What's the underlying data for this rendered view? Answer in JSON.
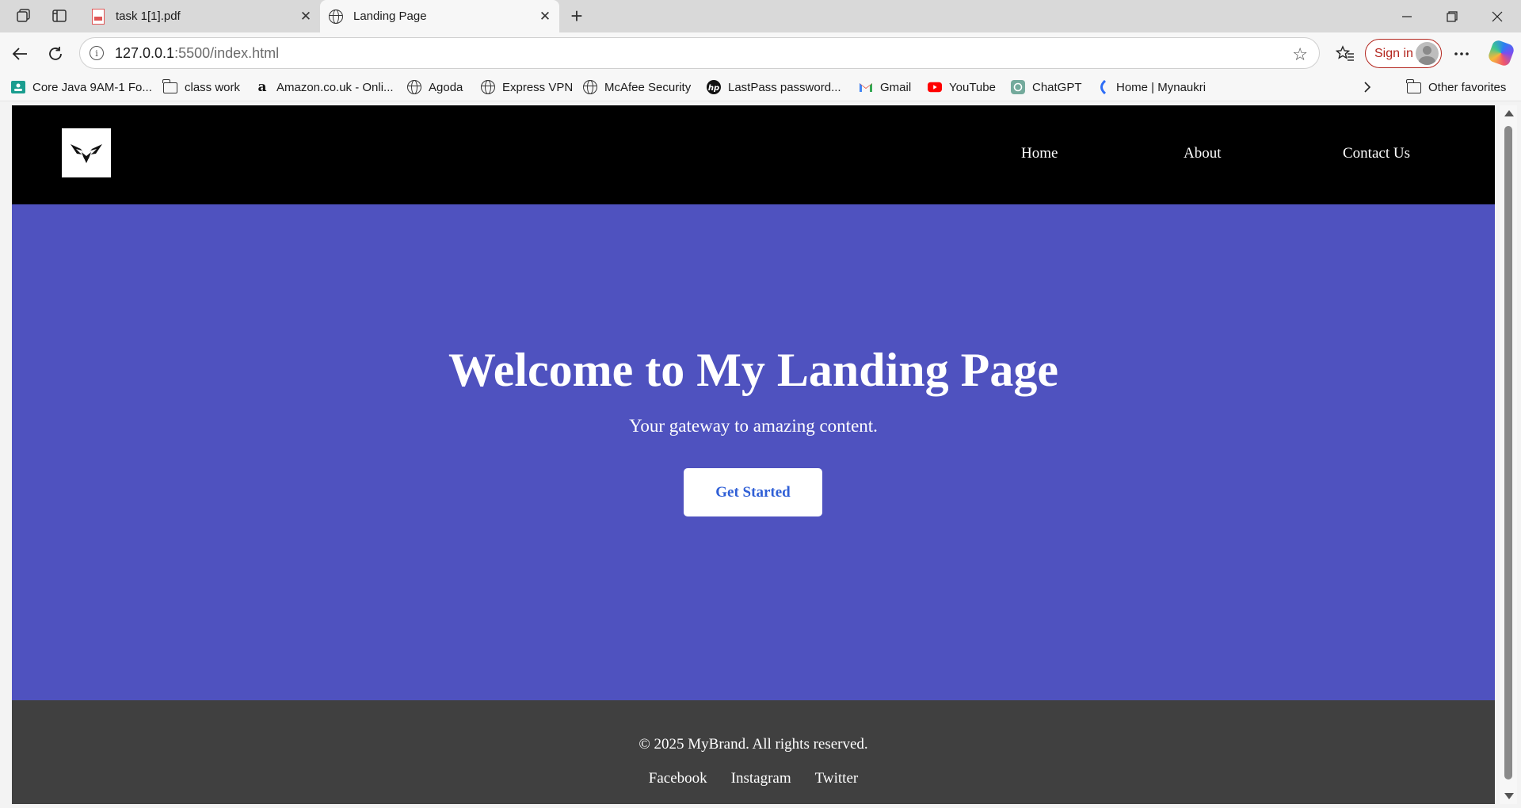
{
  "browser": {
    "tabs": [
      {
        "title": "task 1[1].pdf",
        "icon": "pdf-icon",
        "active": false
      },
      {
        "title": "Landing Page",
        "icon": "globe-icon",
        "active": true
      }
    ],
    "address": {
      "host": "127.0.0.1",
      "path": ":5500/index.html"
    },
    "sign_in_label": "Sign in",
    "bookmarks": [
      {
        "label": "Core Java 9AM-1 Fo...",
        "icon": "classroom-icon"
      },
      {
        "label": "class work",
        "icon": "folder-icon"
      },
      {
        "label": "Amazon.co.uk - Onli...",
        "icon": "amazon-icon"
      },
      {
        "label": "Agoda",
        "icon": "globe-icon"
      },
      {
        "label": "Express VPN",
        "icon": "globe-icon"
      },
      {
        "label": "McAfee Security",
        "icon": "globe-icon"
      },
      {
        "label": "LastPass password...",
        "icon": "hp-icon"
      },
      {
        "label": "Gmail",
        "icon": "gmail-icon"
      },
      {
        "label": "YouTube",
        "icon": "youtube-icon"
      },
      {
        "label": "ChatGPT",
        "icon": "chatgpt-icon"
      },
      {
        "label": "Home | Mynaukri",
        "icon": "naukri-icon"
      }
    ],
    "other_favorites_label": "Other favorites"
  },
  "site": {
    "nav": {
      "home": "Home",
      "about": "About",
      "contact": "Contact Us"
    },
    "hero": {
      "title": "Welcome to My Landing Page",
      "subtitle": "Your gateway to amazing content.",
      "cta_label": "Get Started"
    },
    "footer": {
      "copyright": "© 2025 MyBrand. All rights reserved.",
      "links": [
        "Facebook",
        "Instagram",
        "Twitter"
      ]
    }
  },
  "colors": {
    "header_bg": "#000000",
    "hero_bg": "#4f52bf",
    "footer_bg": "#404040",
    "cta_text": "#2f5fd6"
  }
}
